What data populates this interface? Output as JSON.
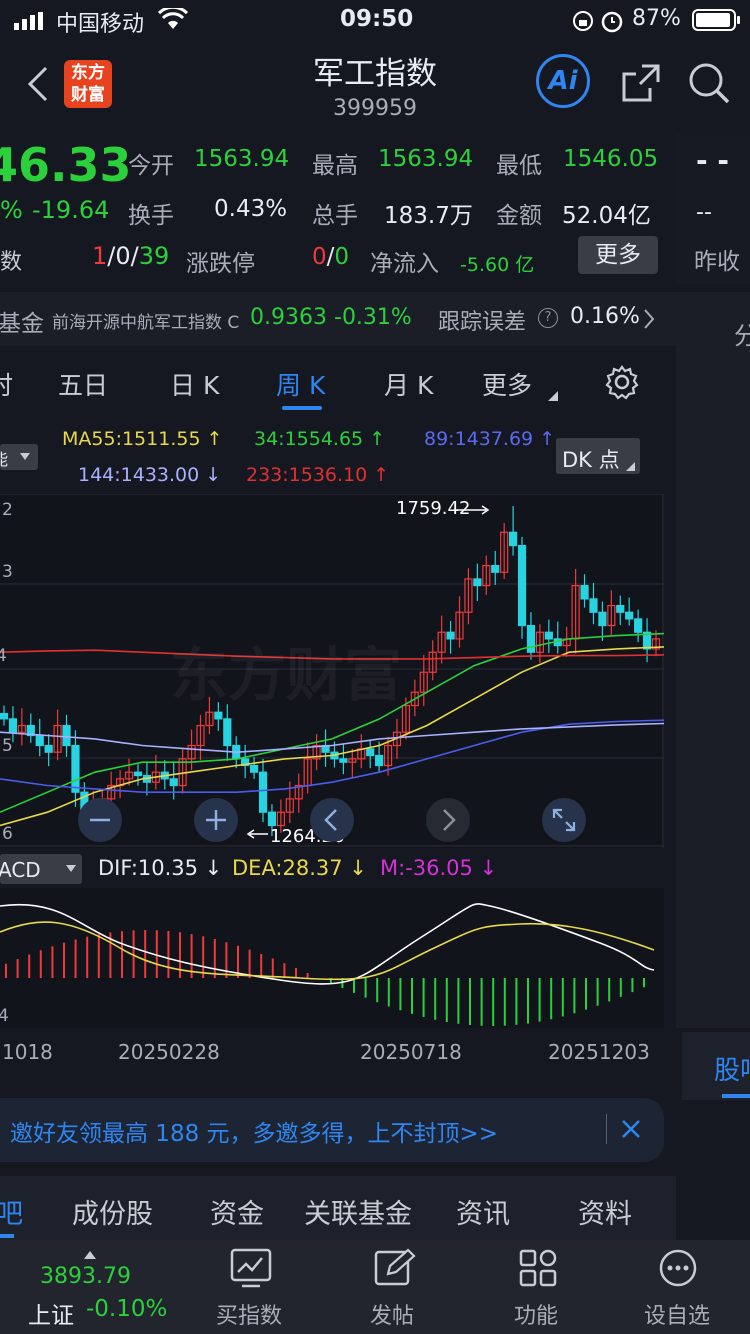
{
  "status_bar": {
    "carrier": "中国移动",
    "time": "09:50",
    "battery": "87%"
  },
  "header": {
    "title": "军工指数",
    "code": "399959",
    "ai_label": "Ai"
  },
  "quote": {
    "price": "46.33",
    "change_pct": "%",
    "change": "-19.64",
    "counts_label": "数",
    "up": "1",
    "flat": "0",
    "down": "39",
    "sep": "/",
    "open_label": "今开",
    "open": "1563.94",
    "high_label": "最高",
    "high": "1563.94",
    "low_label": "最低",
    "low": "1546.05",
    "turnover_label": "换手",
    "turnover": "0.43%",
    "volume_label": "总手",
    "volume": "183.7万",
    "amount_label": "金额",
    "amount": "52.04亿",
    "limit_label": "涨跌停",
    "limit_up": "0",
    "limit_down": "0",
    "inflow_label": "净流入",
    "inflow": "-5.60 亿",
    "more": "更多",
    "right_dash": "- -",
    "right_dash2": "--",
    "prev_close_label": "昨收"
  },
  "fund_bar": {
    "label": "基金",
    "name": "前海开源中航军工指数 C",
    "value": "0.9363",
    "change": "-0.31%",
    "tracking_label": "跟踪误差",
    "tracking": "0.16%",
    "right_char": "分"
  },
  "period_tabs": [
    "时",
    "五日",
    "日 K",
    "周 K",
    "月 K",
    "更多"
  ],
  "active_tab": 3,
  "ma": {
    "ma55": "MA55:1511.55 ↑",
    "ma34": "34:1554.65 ↑",
    "ma89": "89:1437.69 ↑",
    "ma144": "144:1433.00 ↓",
    "ma233": "233:1536.10 ↑",
    "dk": "DK 点",
    "left_label": "能"
  },
  "chart_axis": {
    "y1": "2",
    "y2": "3",
    "y3": "4",
    "y4": "5",
    "y5": "6",
    "max_label": "1759.42",
    "min_label": "1264.26",
    "watermark": "东方财富"
  },
  "macd": {
    "label": "ACD",
    "dif": "DIF:10.35 ↓",
    "dea": "DEA:28.37 ↓",
    "m": "M:-36.05 ↓",
    "y_label": "4"
  },
  "x_axis": {
    "d1": "1018",
    "d2": "20250228",
    "d3": "20250718",
    "d4": "20251203"
  },
  "right_tab": "股吧",
  "banner": {
    "text": "邀好友领最高 188 元，多邀多得，上不封顶>>"
  },
  "section_tabs": [
    "吧",
    "成份股",
    "资金",
    "关联基金",
    "资讯",
    "资料"
  ],
  "bottom_nav": {
    "index_value": "3893.79",
    "index_name": "上证",
    "index_change": "-0.10%",
    "items": [
      "买指数",
      "发帖",
      "功能",
      "设自选"
    ]
  },
  "colors": {
    "up": "#f03a3a",
    "down": "#2bd13a",
    "ma55": "#e8d84a",
    "ma34": "#2bd13a",
    "ma89": "#4a5de8",
    "ma144": "#aab0ff",
    "ma233": "#e03030",
    "accent": "#2f86f0"
  },
  "chart_data": {
    "type": "candlestick",
    "note_labels": [
      "1759.42",
      "1264.26"
    ],
    "high": 1759.42,
    "low": 1264.26
  }
}
